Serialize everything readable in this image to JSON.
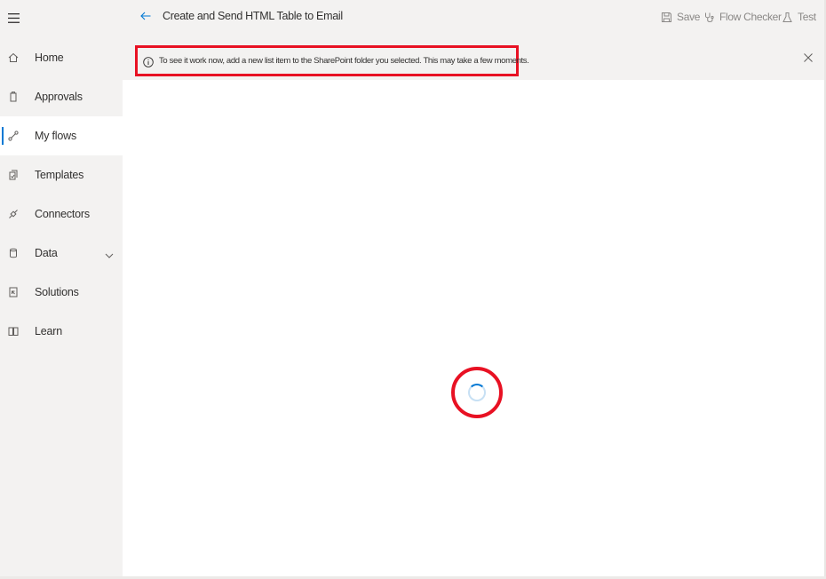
{
  "sidebar": {
    "menu_icon": "hamburger-icon",
    "items": [
      {
        "label": "Home",
        "icon": "home-icon",
        "selected": false
      },
      {
        "label": "Approvals",
        "icon": "approvals-icon",
        "selected": false
      },
      {
        "label": "My flows",
        "icon": "flows-icon",
        "selected": true
      },
      {
        "label": "Templates",
        "icon": "templates-icon",
        "selected": false
      },
      {
        "label": "Connectors",
        "icon": "connectors-icon",
        "selected": false
      },
      {
        "label": "Data",
        "icon": "data-icon",
        "selected": false,
        "expandable": true
      },
      {
        "label": "Solutions",
        "icon": "solutions-icon",
        "selected": false
      },
      {
        "label": "Learn",
        "icon": "learn-icon",
        "selected": false
      }
    ]
  },
  "header": {
    "back_icon": "back-arrow-icon",
    "title": "Create and Send HTML Table to Email",
    "commands": {
      "save": "Save",
      "flow_checker": "Flow Checker",
      "test": "Test"
    }
  },
  "banner": {
    "icon": "info-icon",
    "message": "To see it work now, add a new list item to the SharePoint folder you selected. This may take a few moments.",
    "close_label": "X"
  },
  "canvas": {
    "state": "loading"
  },
  "colors": {
    "accent": "#0078d4",
    "highlight": "#e81123",
    "sidebar_bg": "#f3f2f1"
  }
}
